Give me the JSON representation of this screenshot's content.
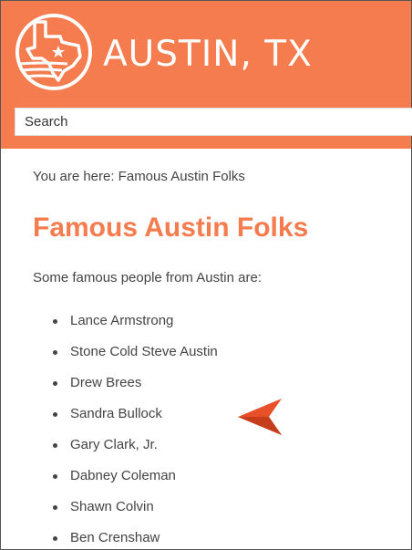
{
  "header": {
    "site_title": "AUSTIN, TX",
    "logo_icon": "texas-map-icon",
    "brand_color": "#f47c4e"
  },
  "search": {
    "placeholder": "Search"
  },
  "breadcrumb": {
    "text": "You are here: Famous Austin Folks"
  },
  "main": {
    "title": "Famous Austin Folks",
    "title_color": "#f47c4e",
    "intro": "Some famous people from Austin are:",
    "people": [
      "Lance Armstrong",
      "Stone Cold Steve Austin",
      "Drew Brees",
      "Sandra Bullock",
      "Gary Clark, Jr.",
      "Dabney Coleman",
      "Shawn Colvin",
      "Ben Crenshaw"
    ]
  },
  "cursor": {
    "icon": "pointer-arrow-icon",
    "color": "#e8502a"
  }
}
